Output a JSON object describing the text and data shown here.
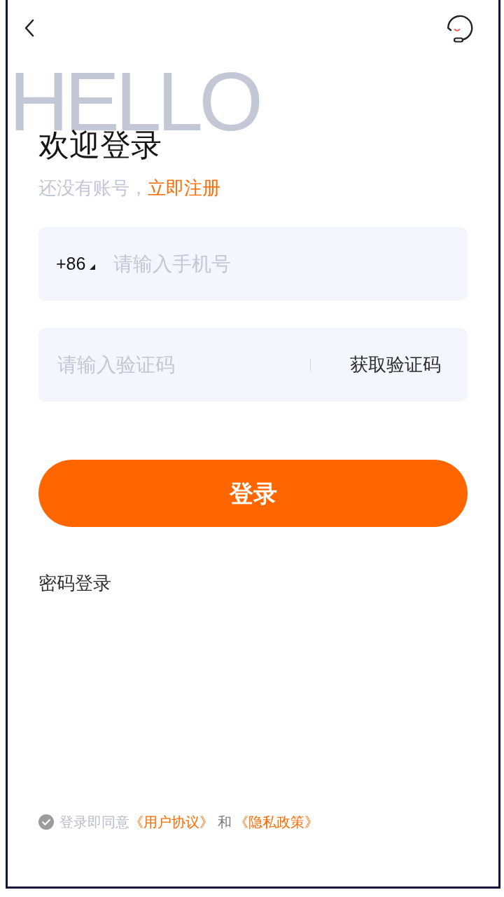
{
  "background_text": "HELLO",
  "title": "欢迎登录",
  "register_prompt": {
    "text": "还没有账号，",
    "link": "立即注册"
  },
  "phone_field": {
    "country_code": "+86",
    "placeholder": "请输入手机号"
  },
  "code_field": {
    "placeholder": "请输入验证码",
    "action": "获取验证码"
  },
  "login_button": "登录",
  "alt_login": "密码登录",
  "agreement": {
    "checked": false,
    "parts": [
      {
        "kind": "hint",
        "text": "登录即同意"
      },
      {
        "kind": "link",
        "text": "《用户协议》"
      },
      {
        "kind": "text",
        "text": "和"
      },
      {
        "kind": "link",
        "text": "《隐私政策》"
      }
    ]
  }
}
